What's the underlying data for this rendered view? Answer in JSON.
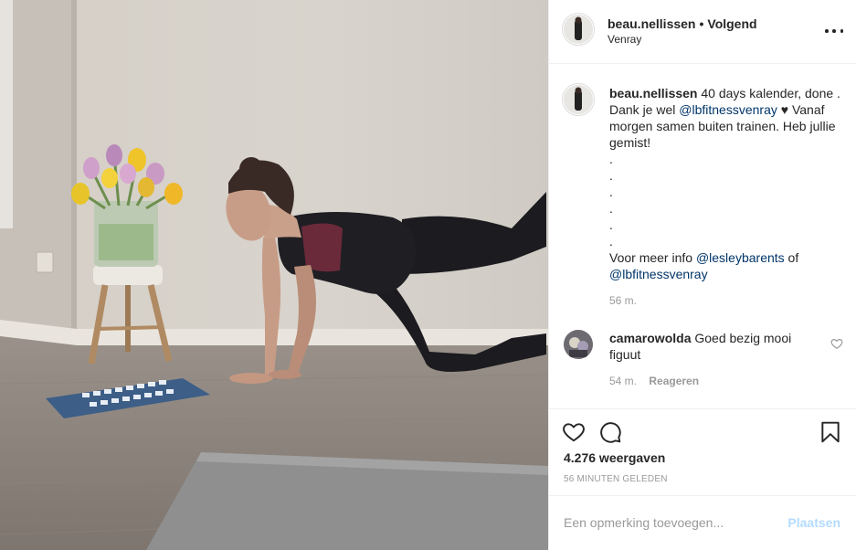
{
  "post": {
    "username": "beau.nellissen",
    "separator": "•",
    "follow_status": "Volgend",
    "location": "Venray",
    "caption": {
      "text_1": "40 days kalender, done . Dank je wel",
      "mention_1": "@lbfitnessvenray",
      "text_2": "♥ Vanaf morgen samen buiten trainen. Heb jullie gemist!",
      "bullets": [
        ".",
        ".",
        ".",
        ".",
        ".",
        "."
      ],
      "text_3": "Voor meer info",
      "mention_2": "@lesleybarents",
      "text_4": "of",
      "mention_3": "@lbfitnessvenray"
    },
    "caption_time": "56 m."
  },
  "comments": [
    {
      "username": "camarowolda",
      "text": "Goed bezig mooi figuut",
      "time": "54 m.",
      "reply_label": "Reageren"
    }
  ],
  "stats": {
    "views": "4.276 weergaven",
    "posted_ago": "56 MINUTEN GELEDEN"
  },
  "comment_box": {
    "placeholder": "Een opmerking toevoegen...",
    "post_label": "Plaatsen"
  },
  "icons": [
    "more-icon",
    "heart-icon",
    "comment-icon",
    "bookmark-icon"
  ],
  "colors": {
    "text": "#262626",
    "muted": "#999999",
    "mention": "#003569",
    "post_button": "#b3dbff",
    "divider": "#efefef"
  }
}
